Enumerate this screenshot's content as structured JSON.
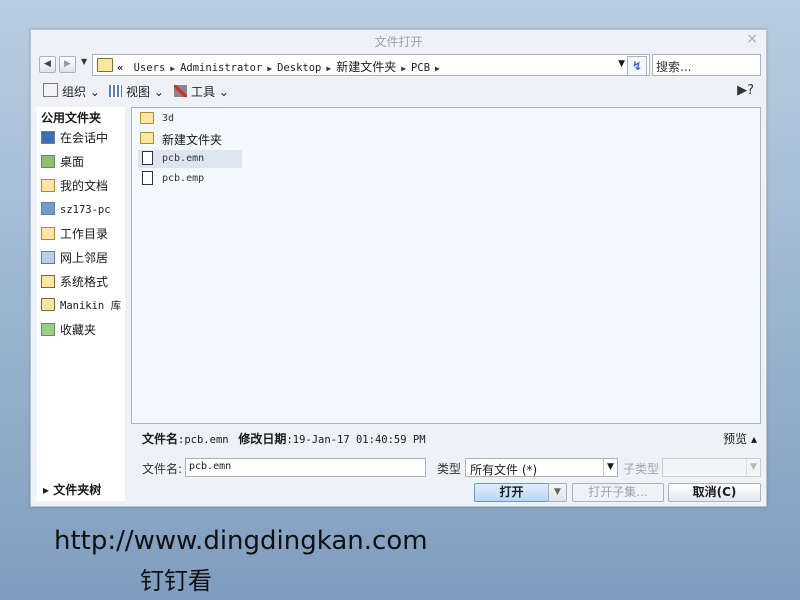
{
  "dialog": {
    "title": "文件打开",
    "close_glyph": "×"
  },
  "nav": {
    "back_glyph": "◀",
    "forward_glyph": "▶",
    "dropdown_glyph": "▼",
    "crumb_prefix": "«",
    "breadcrumbs": [
      "Users",
      "Administrator",
      "Desktop",
      "新建文件夹",
      "PCB"
    ],
    "refresh_glyph": "↯",
    "search_placeholder": "搜索..."
  },
  "toolbar": {
    "organize": "组织 ⌄",
    "view": "视图 ⌄",
    "tools": "工具 ⌄",
    "help_glyph": "▶?"
  },
  "sidebar": {
    "heading": "公用文件夹",
    "items": [
      {
        "label": "在会话中",
        "icon": "session-icon"
      },
      {
        "label": "桌面",
        "icon": "desktop-icon"
      },
      {
        "label": "我的文档",
        "icon": "documents-icon"
      },
      {
        "label": "sz173-pc",
        "icon": "computer-icon"
      },
      {
        "label": "工作目录",
        "icon": "workdir-icon"
      },
      {
        "label": "网上邻居",
        "icon": "network-icon"
      },
      {
        "label": "系统格式",
        "icon": "system-format-icon"
      },
      {
        "label": "Manikin 库",
        "icon": "library-icon"
      },
      {
        "label": "收藏夹",
        "icon": "favorites-icon"
      }
    ],
    "tree_toggle": "▸ 文件夹树"
  },
  "files": [
    {
      "name": "3d",
      "type": "folder",
      "selected": false
    },
    {
      "name": "新建文件夹",
      "type": "folder",
      "selected": false
    },
    {
      "name": "pcb.emn",
      "type": "file",
      "selected": true
    },
    {
      "name": "pcb.emp",
      "type": "file",
      "selected": false
    }
  ],
  "info": {
    "filename_label": "文件名",
    "filename_value": ":pcb.emn",
    "modified_label": "修改日期",
    "modified_value": ":19-Jan-17 01:40:59 PM",
    "preview": "预览 ▴"
  },
  "form": {
    "filename_label": "文件名:",
    "filename_value": "pcb.emn",
    "type_label": "类型",
    "type_value": "所有文件 (*)",
    "subtype_label": "子类型"
  },
  "buttons": {
    "open": "打开",
    "open_dd": "▼",
    "open_subset": "打开子集...",
    "cancel": "取消(C)"
  },
  "watermark": {
    "url": "http://www.dingdingkan.com",
    "name": "钉钉看"
  },
  "colors": {
    "accent": "#b9d7f3",
    "pane_bg": "#f4f9fd",
    "selected_bg": "#dde6f0"
  }
}
